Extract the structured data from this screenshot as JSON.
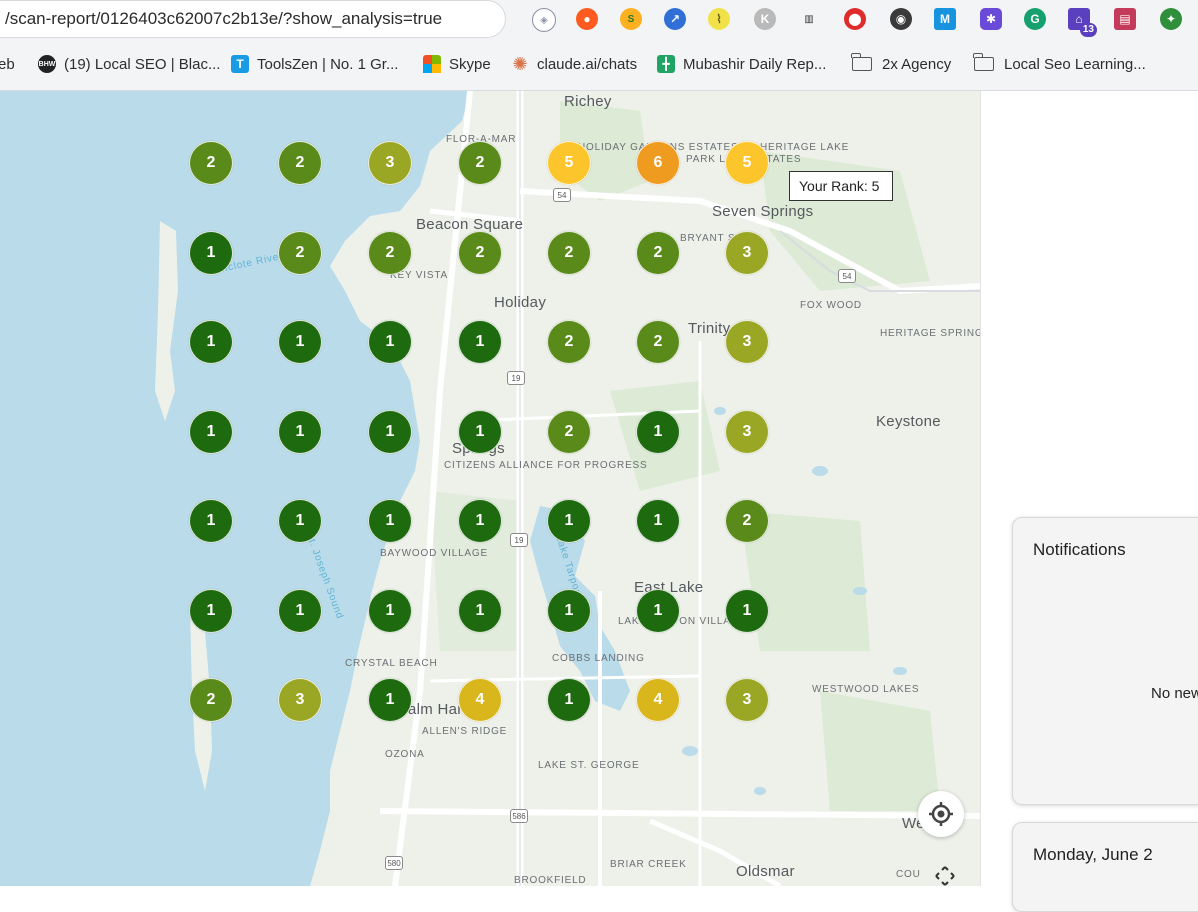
{
  "browser": {
    "url": "/scan-report/0126403c62007c2b13e/?show_analysis=true",
    "extension_badge": "13",
    "bookmarks": [
      {
        "label": "eb",
        "icon": "none"
      },
      {
        "label": "(19) Local SEO | Blac...",
        "icon": "bhw-icon"
      },
      {
        "label": "ToolsZen | No. 1 Gr...",
        "icon": "toolszen-icon"
      },
      {
        "label": "Skype",
        "icon": "windows-logo-icon"
      },
      {
        "label": "claude.ai/chats",
        "icon": "claude-icon"
      },
      {
        "label": "Mubashir Daily Rep...",
        "icon": "sheets-icon"
      },
      {
        "label": "2x Agency",
        "icon": "folder-icon"
      },
      {
        "label": "Local Seo Learning...",
        "icon": "folder-icon"
      }
    ]
  },
  "map": {
    "grid_ranks": [
      [
        2,
        2,
        3,
        2,
        5,
        6,
        5
      ],
      [
        1,
        2,
        2,
        2,
        2,
        2,
        3
      ],
      [
        1,
        1,
        1,
        1,
        2,
        2,
        3
      ],
      [
        1,
        1,
        1,
        1,
        2,
        1,
        3
      ],
      [
        1,
        1,
        1,
        1,
        1,
        1,
        2
      ],
      [
        1,
        1,
        1,
        1,
        1,
        1,
        1
      ],
      [
        2,
        3,
        1,
        4,
        1,
        4,
        3
      ]
    ],
    "rank_colors": {
      "1": "#1e6a0e",
      "2": "#5a8a1a",
      "3": "#9aa725",
      "4": "#d8b61c",
      "5": "#fbc52b",
      "6": "#ef9b1f"
    },
    "tooltip": "Your Rank: 5",
    "places": {
      "richey": "Richey",
      "flor_a_mar": "FLOR-A-MAR",
      "holiday_gardens": "HOLIDAY GARDENS ESTATES",
      "park_lake": "PARK LAKE ESTATES",
      "heritage_lake": "HERITAGE LAKE",
      "seven_springs": "Seven Springs",
      "beacon_square": "Beacon Square",
      "key_vista": "KEY VISTA",
      "bryant_square": "BRYANT SQ",
      "holiday": "Holiday",
      "fox_wood": "FOX WOOD",
      "trinity": "Trinity",
      "heritage_springs": "HERITAGE SPRINGS",
      "keystone": "Keystone",
      "tarpon_springs": "Springs",
      "citizens_alliance": "CITIZENS ALLIANCE FOR PROGRESS",
      "baywood_village": "BAYWOOD VILLAGE",
      "east_lake": "East Lake",
      "lake_tarpon": "LAKE TARPON VILLAGE",
      "crystal_beach": "CRYSTAL BEACH",
      "cobbs_landing": "COBBS LANDING",
      "westwood_lakes": "WESTWOOD LAKES",
      "palm_harbor": "alm Har",
      "allens_ridge": "ALLEN'S RIDGE",
      "ozona": "OZONA",
      "lake_st_george": "LAKE ST. GEORGE",
      "briar_creek": "BRIAR CREEK",
      "oldsmar": "Oldsmar",
      "brookfield": "BROOKFIELD",
      "westchase": "We     se",
      "country": "COU",
      "anclote": "Anclote River",
      "st_joseph": "St. Joseph Sound",
      "lake_tarpon_water": "Lake Tarpon"
    },
    "road_shields": [
      "54",
      "54",
      "19",
      "19",
      "19",
      "586",
      "580"
    ]
  },
  "notifications": {
    "title": "Notifications",
    "empty": "No new"
  },
  "date_card": {
    "title": "Monday, June 2"
  }
}
